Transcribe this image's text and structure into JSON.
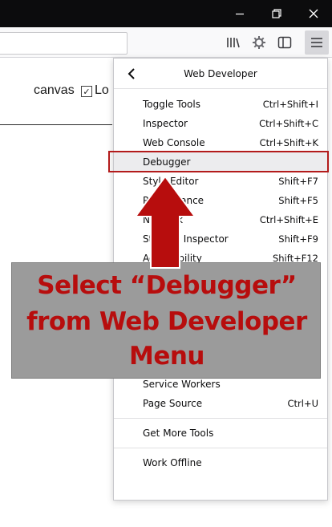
{
  "window": {
    "minimize_icon": "minimize-icon",
    "maximize_icon": "restore-icon",
    "close_icon": "close-icon"
  },
  "toolbar": {
    "library_icon": "library-icon",
    "extension_icon": "gear-icon",
    "sidebar_icon": "sidebar-icon",
    "menu_icon": "hamburger-menu-icon"
  },
  "page": {
    "text": "canvas",
    "checkbox_checked": true,
    "text2": "Lo"
  },
  "menu": {
    "title": "Web Developer",
    "back_icon": "chevron-left-icon",
    "items": [
      {
        "label": "Toggle Tools",
        "shortcut": "Ctrl+Shift+I"
      },
      {
        "label": "Inspector",
        "shortcut": "Ctrl+Shift+C"
      },
      {
        "label": "Web Console",
        "shortcut": "Ctrl+Shift+K"
      },
      {
        "label": "Debugger",
        "shortcut": ""
      },
      {
        "label": "Style Editor",
        "shortcut": "Shift+F7"
      },
      {
        "label": "Performance",
        "shortcut": "Shift+F5"
      },
      {
        "label": "Network",
        "shortcut": "Ctrl+Shift+E"
      },
      {
        "label": "Storage Inspector",
        "shortcut": "Shift+F9"
      },
      {
        "label": "Accessibility",
        "shortcut": "Shift+F12"
      },
      {
        "label": "Service Workers",
        "shortcut": ""
      },
      {
        "label": "Page Source",
        "shortcut": "Ctrl+U"
      },
      {
        "label": "Get More Tools",
        "shortcut": ""
      },
      {
        "label": "Work Offline",
        "shortcut": ""
      }
    ]
  },
  "annotation": {
    "line1": "Select “Debugger”",
    "line2": "from Web Developer",
    "line3": "Menu",
    "color": "#b70d0d",
    "arrow_icon": "up-arrow-icon"
  }
}
